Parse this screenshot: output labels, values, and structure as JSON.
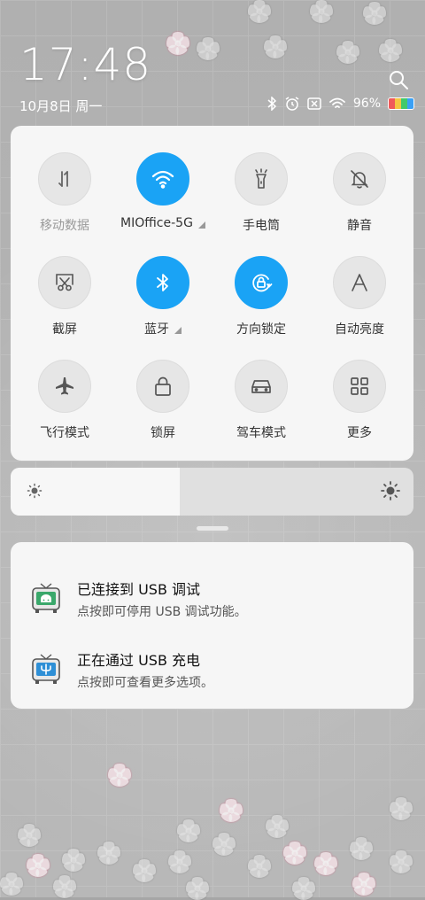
{
  "status_bar": {
    "time": "17:48",
    "date": "10月8日 周一",
    "battery_percent": "96%",
    "icons": [
      "bluetooth-icon",
      "alarm-icon",
      "no-sim-icon",
      "wifi-icon",
      "battery-icon"
    ]
  },
  "quick_settings": {
    "tiles": [
      {
        "id": "mobile-data",
        "label": "移动数据",
        "icon": "mobile-data-icon",
        "on": false,
        "disabled": true
      },
      {
        "id": "wifi",
        "label": "MIOffice-5G",
        "icon": "wifi-icon",
        "on": true,
        "has_more": true
      },
      {
        "id": "flashlight",
        "label": "手电筒",
        "icon": "flashlight-icon",
        "on": false
      },
      {
        "id": "mute",
        "label": "静音",
        "icon": "bell-off-icon",
        "on": false
      },
      {
        "id": "screenshot",
        "label": "截屏",
        "icon": "screenshot-icon",
        "on": false
      },
      {
        "id": "bluetooth",
        "label": "蓝牙",
        "icon": "bluetooth-icon",
        "on": true,
        "has_more": true
      },
      {
        "id": "rotation-lock",
        "label": "方向锁定",
        "icon": "rotation-lock-icon",
        "on": true
      },
      {
        "id": "auto-brightness",
        "label": "自动亮度",
        "icon": "auto-brightness-icon",
        "on": false
      },
      {
        "id": "airplane",
        "label": "飞行模式",
        "icon": "airplane-icon",
        "on": false
      },
      {
        "id": "lock-screen",
        "label": "锁屏",
        "icon": "lock-icon",
        "on": false
      },
      {
        "id": "driving-mode",
        "label": "驾车模式",
        "icon": "car-icon",
        "on": false
      },
      {
        "id": "more",
        "label": "更多",
        "icon": "grid-icon",
        "on": false
      }
    ]
  },
  "brightness": {
    "level": 0.42
  },
  "notifications": [
    {
      "title": "已连接到 USB 调试",
      "body": "点按即可停用 USB 调试功能。",
      "icon": "android-debug-icon"
    },
    {
      "title": "正在通过 USB 充电",
      "body": "点按即可查看更多选项。",
      "icon": "usb-charging-icon"
    }
  ],
  "colors": {
    "accent": "#1aa3f5",
    "panel": "#f6f6f6",
    "battery_colors": [
      "#f05a5a",
      "#f5c542",
      "#41c96b",
      "#3aa0f5"
    ]
  }
}
